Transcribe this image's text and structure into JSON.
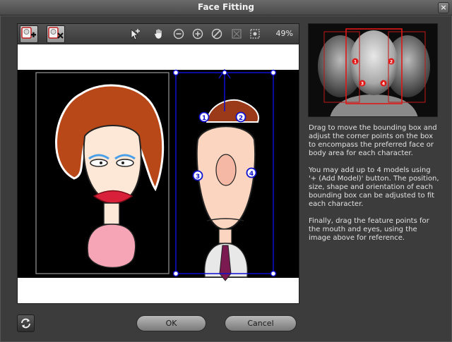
{
  "window": {
    "title": "Face Fitting",
    "close_label": "×"
  },
  "toolbar": {
    "add_model_icon": "add-model-icon",
    "remove_model_icon": "remove-model-icon",
    "zoom_level": "49%"
  },
  "markers": {
    "p1": "1",
    "p2": "2",
    "p3": "3",
    "p4": "4"
  },
  "reference": {
    "m1": "1",
    "m2": "2",
    "m3": "3",
    "m4": "4"
  },
  "instructions": {
    "p1": "Drag to move the bounding box and adjust the corner points on the box to encompass the preferred face or body area for each character.",
    "p2": "You may add up to 4 models using '+ (Add Model)' button. The position, size, shape and orientation of each bounding box can be adjusted to fit each character.",
    "p3": "Finally, drag the feature points for the mouth and eyes, using the image above for reference."
  },
  "buttons": {
    "ok": "OK",
    "cancel": "Cancel"
  },
  "colors": {
    "bbox_blue": "#1010d0",
    "ref_red": "#e01818",
    "background": "#3a3a3a"
  }
}
